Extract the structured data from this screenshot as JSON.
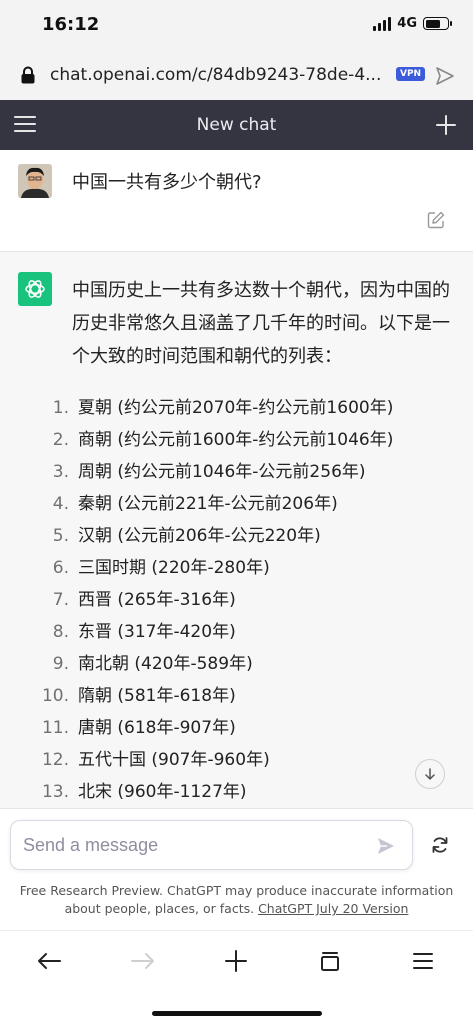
{
  "status_bar": {
    "time": "16:12",
    "network": "4G"
  },
  "browser": {
    "url": "chat.openai.com/c/84db9243-78de-4...",
    "vpn_badge": "VPN"
  },
  "header": {
    "title": "New chat"
  },
  "user_message": {
    "text": "中国一共有多少个朝代?"
  },
  "assistant_message": {
    "intro": "中国历史上一共有多达数十个朝代，因为中国的历史非常悠久且涵盖了几千年的时间。以下是一个大致的时间范围和朝代的列表：",
    "dynasties": [
      {
        "num": "1.",
        "text": "夏朝 (约公元前2070年-约公元前1600年)"
      },
      {
        "num": "2.",
        "text": "商朝 (约公元前1600年-约公元前1046年)"
      },
      {
        "num": "3.",
        "text": "周朝 (约公元前1046年-公元前256年)"
      },
      {
        "num": "4.",
        "text": "秦朝 (公元前221年-公元前206年)"
      },
      {
        "num": "5.",
        "text": "汉朝 (公元前206年-公元220年)"
      },
      {
        "num": "6.",
        "text": "三国时期 (220年-280年)"
      },
      {
        "num": "7.",
        "text": "西晋 (265年-316年)"
      },
      {
        "num": "8.",
        "text": "东晋 (317年-420年)"
      },
      {
        "num": "9.",
        "text": "南北朝 (420年-589年)"
      },
      {
        "num": "10.",
        "text": "隋朝 (581年-618年)"
      },
      {
        "num": "11.",
        "text": "唐朝 (618年-907年)"
      },
      {
        "num": "12.",
        "text": "五代十国 (907年-960年)"
      },
      {
        "num": "13.",
        "text": "北宋 (960年-1127年)"
      }
    ]
  },
  "composer": {
    "placeholder": "Send a message"
  },
  "disclaimer": {
    "text": "Free Research Preview. ChatGPT may produce inaccurate information about people, places, or facts.",
    "link": "ChatGPT July 20 Version"
  },
  "colors": {
    "header_bg": "#343541",
    "assistant_bg": "#f7f7f8",
    "gpt_green": "#19c37d",
    "vpn_blue": "#3b5bdb"
  },
  "icons": [
    "lock-icon",
    "send-url-icon",
    "menu-icon",
    "plus-icon",
    "edit-icon",
    "openai-logo-icon",
    "arrow-down-icon",
    "send-icon",
    "regenerate-icon",
    "back-icon",
    "forward-icon",
    "new-tab-icon",
    "tabs-icon",
    "browser-menu-icon"
  ]
}
